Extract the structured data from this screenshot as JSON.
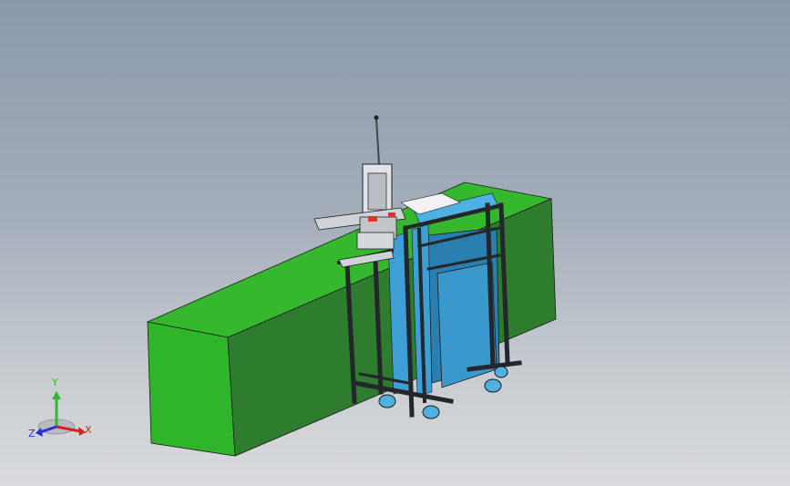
{
  "viewport": {
    "background_top": "#8b99ab",
    "background_bottom": "#d9dbdd"
  },
  "model": {
    "base_color": "#2fb52a",
    "base_dark": "#2e7c2e",
    "frame_color": "#23272b",
    "panel_color": "#3d9fd6",
    "panel_dark": "#2a7fb0",
    "accent_color": "#d8382a"
  },
  "triad": {
    "x_label": "X",
    "y_label": "Y",
    "z_label": "Z",
    "x_color": "#d22222",
    "y_color": "#2fb82f",
    "z_color": "#2233cc"
  }
}
